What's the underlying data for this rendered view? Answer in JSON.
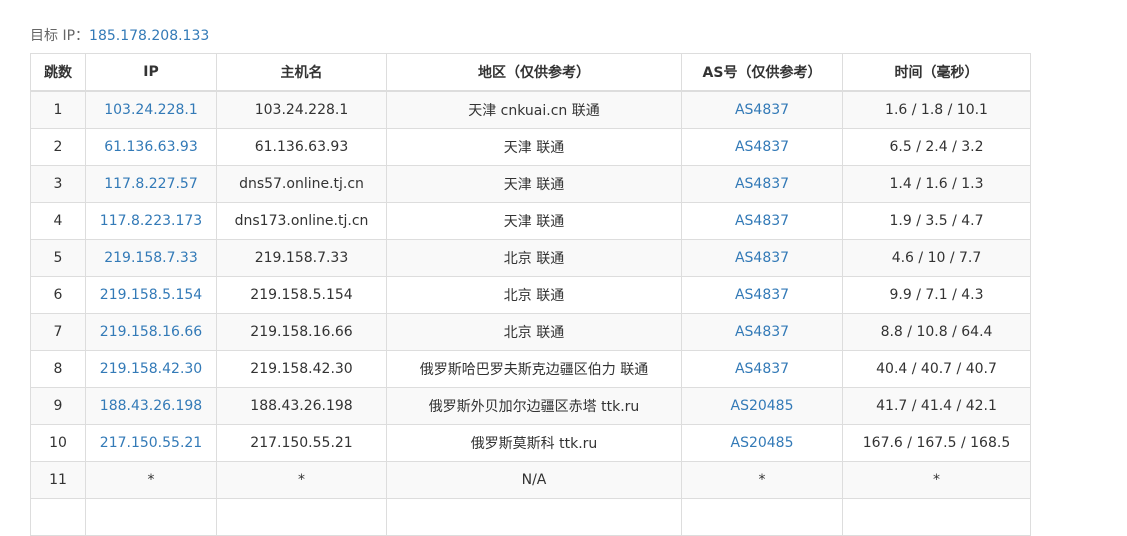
{
  "target": {
    "label": "目标 IP：",
    "ip": "185.178.208.133"
  },
  "table": {
    "headers": [
      "跳数",
      "IP",
      "主机名",
      "地区（仅供参考）",
      "AS号（仅供参考）",
      "时间（毫秒）"
    ],
    "rows": [
      {
        "hop": "1",
        "ip": "103.24.228.1",
        "host": "103.24.228.1",
        "region": "天津 cnkuai.cn 联通",
        "as": "AS4837",
        "time": "1.6 / 1.8 / 10.1"
      },
      {
        "hop": "2",
        "ip": "61.136.63.93",
        "host": "61.136.63.93",
        "region": "天津 联通",
        "as": "AS4837",
        "time": "6.5 / 2.4 / 3.2"
      },
      {
        "hop": "3",
        "ip": "117.8.227.57",
        "host": "dns57.online.tj.cn",
        "region": "天津 联通",
        "as": "AS4837",
        "time": "1.4 / 1.6 / 1.3"
      },
      {
        "hop": "4",
        "ip": "117.8.223.173",
        "host": "dns173.online.tj.cn",
        "region": "天津 联通",
        "as": "AS4837",
        "time": "1.9 / 3.5 / 4.7"
      },
      {
        "hop": "5",
        "ip": "219.158.7.33",
        "host": "219.158.7.33",
        "region": "北京 联通",
        "as": "AS4837",
        "time": "4.6 / 10 / 7.7"
      },
      {
        "hop": "6",
        "ip": "219.158.5.154",
        "host": "219.158.5.154",
        "region": "北京 联通",
        "as": "AS4837",
        "time": "9.9 / 7.1 / 4.3"
      },
      {
        "hop": "7",
        "ip": "219.158.16.66",
        "host": "219.158.16.66",
        "region": "北京 联通",
        "as": "AS4837",
        "time": "8.8 / 10.8 / 64.4"
      },
      {
        "hop": "8",
        "ip": "219.158.42.30",
        "host": "219.158.42.30",
        "region": "俄罗斯哈巴罗夫斯克边疆区伯力 联通",
        "as": "AS4837",
        "time": "40.4 / 40.7 / 40.7"
      },
      {
        "hop": "9",
        "ip": "188.43.26.198",
        "host": "188.43.26.198",
        "region": "俄罗斯外贝加尔边疆区赤塔 ttk.ru",
        "as": "AS20485",
        "time": "41.7 / 41.4 / 42.1"
      },
      {
        "hop": "10",
        "ip": "217.150.55.21",
        "host": "217.150.55.21",
        "region": "俄罗斯莫斯科 ttk.ru",
        "as": "AS20485",
        "time": "167.6 / 167.5 / 168.5"
      },
      {
        "hop": "11",
        "ip": "*",
        "host": "*",
        "region": "N/A",
        "as": "*",
        "time": "*"
      },
      {
        "hop": "",
        "ip": "",
        "host": "",
        "region": "",
        "as": "",
        "time": ""
      }
    ]
  },
  "colors": {
    "link": "#337ab7",
    "text": "#333333",
    "border": "#dddddd",
    "stripe": "#f9f9f9"
  }
}
